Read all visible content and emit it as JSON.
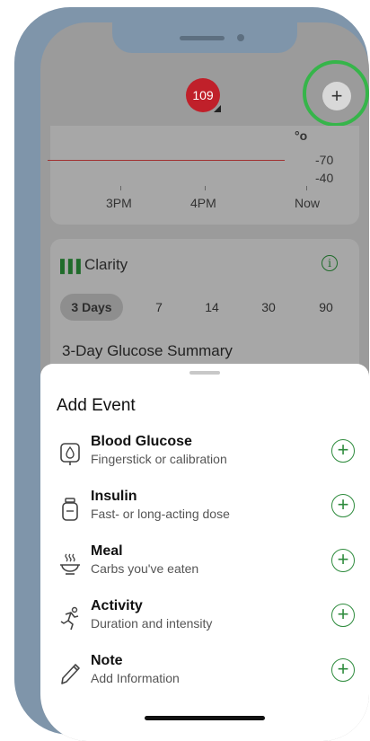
{
  "header": {
    "glucose_badge": "109",
    "add_button_label": "+"
  },
  "graph": {
    "unit_fragment": "°o",
    "high_label": "-70",
    "low_label": "-40",
    "x_labels": [
      "3PM",
      "4PM",
      "Now"
    ]
  },
  "clarity": {
    "title": "Clarity",
    "info_glyph": "i",
    "ranges": [
      "3 Days",
      "7",
      "14",
      "30",
      "90"
    ],
    "selected_range": "3 Days",
    "summary_title": "3-Day Glucose Summary"
  },
  "sheet": {
    "title": "Add Event",
    "add_glyph": "+",
    "items": [
      {
        "title": "Blood Glucose",
        "subtitle": "Fingerstick or calibration",
        "icon": "blood-drop-icon"
      },
      {
        "title": "Insulin",
        "subtitle": "Fast- or long-acting dose",
        "icon": "insulin-vial-icon"
      },
      {
        "title": "Meal",
        "subtitle": "Carbs you've eaten",
        "icon": "meal-bowl-icon"
      },
      {
        "title": "Activity",
        "subtitle": "Duration and intensity",
        "icon": "running-icon"
      },
      {
        "title": "Note",
        "subtitle": "Add Information",
        "icon": "pencil-icon"
      }
    ]
  },
  "colors": {
    "accent_green": "#2e8b3d",
    "badge_red": "#c0202a",
    "highlight_ring": "#36b54a"
  }
}
